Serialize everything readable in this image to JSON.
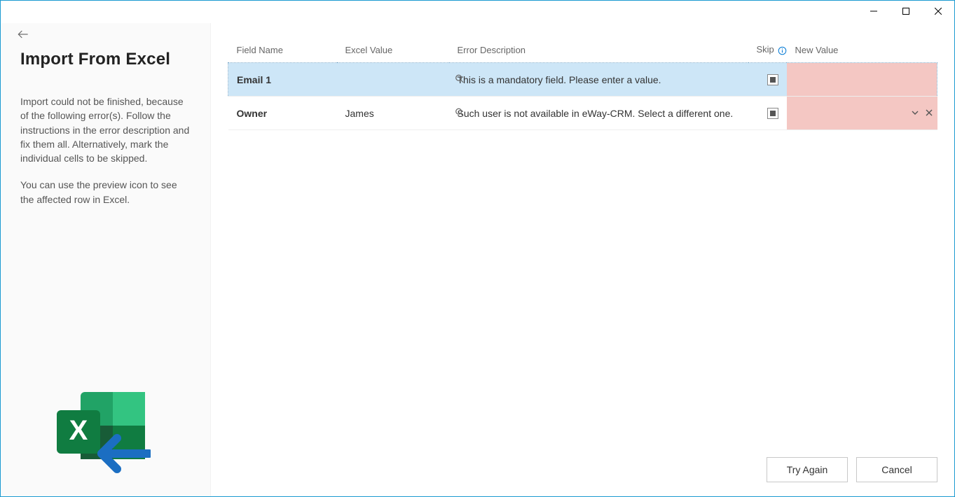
{
  "titlebar": {
    "minimize": "minimize",
    "maximize": "maximize",
    "close": "close"
  },
  "sidebar": {
    "title": "Import From Excel",
    "paragraph1": "Import could not be finished, because of the following error(s). Follow the instructions in the error description and fix them all. Alternatively, mark the individual cells to be skipped.",
    "paragraph2": "You can use the preview icon to see the affected row in Excel."
  },
  "table": {
    "headers": {
      "field_name": "Field Name",
      "excel_value": "Excel Value",
      "error_description": "Error Description",
      "skip": "Skip",
      "new_value": "New Value"
    },
    "rows": [
      {
        "field_name": "Email 1",
        "excel_value": "",
        "error_description": "This is a mandatory field. Please enter a value.",
        "new_value": ""
      },
      {
        "field_name": "Owner",
        "excel_value": "James",
        "error_description": "Such user is not available in eWay-CRM. Select a different one.",
        "new_value": ""
      }
    ]
  },
  "footer": {
    "try_again": "Try Again",
    "cancel": "Cancel"
  },
  "colors": {
    "window_border": "#1b9ad1",
    "selected_row": "#cde6f7",
    "newval_bg": "#f4c7c3",
    "info_icon": "#0078d4"
  }
}
